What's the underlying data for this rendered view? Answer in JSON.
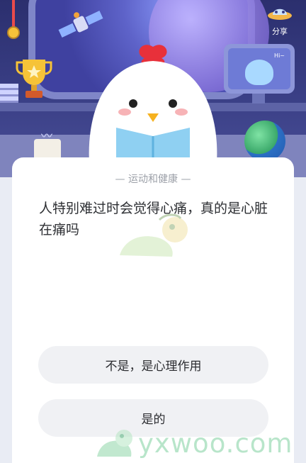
{
  "header": {
    "share_label": "分享",
    "monitor_text": "Hi~"
  },
  "quiz": {
    "category": "— 运动和健康 —",
    "question": "人特别难过时会觉得心痛，真的是心脏在痛吗",
    "options": [
      {
        "label": "不是，是心理作用"
      },
      {
        "label": "是的"
      }
    ]
  },
  "watermark": {
    "text": "yxwoo.com"
  },
  "colors": {
    "card_bg": "#ffffff",
    "option_bg": "#f0f1f4",
    "scene_bg": "#3a3f86",
    "chick_comb": "#e8303a"
  }
}
